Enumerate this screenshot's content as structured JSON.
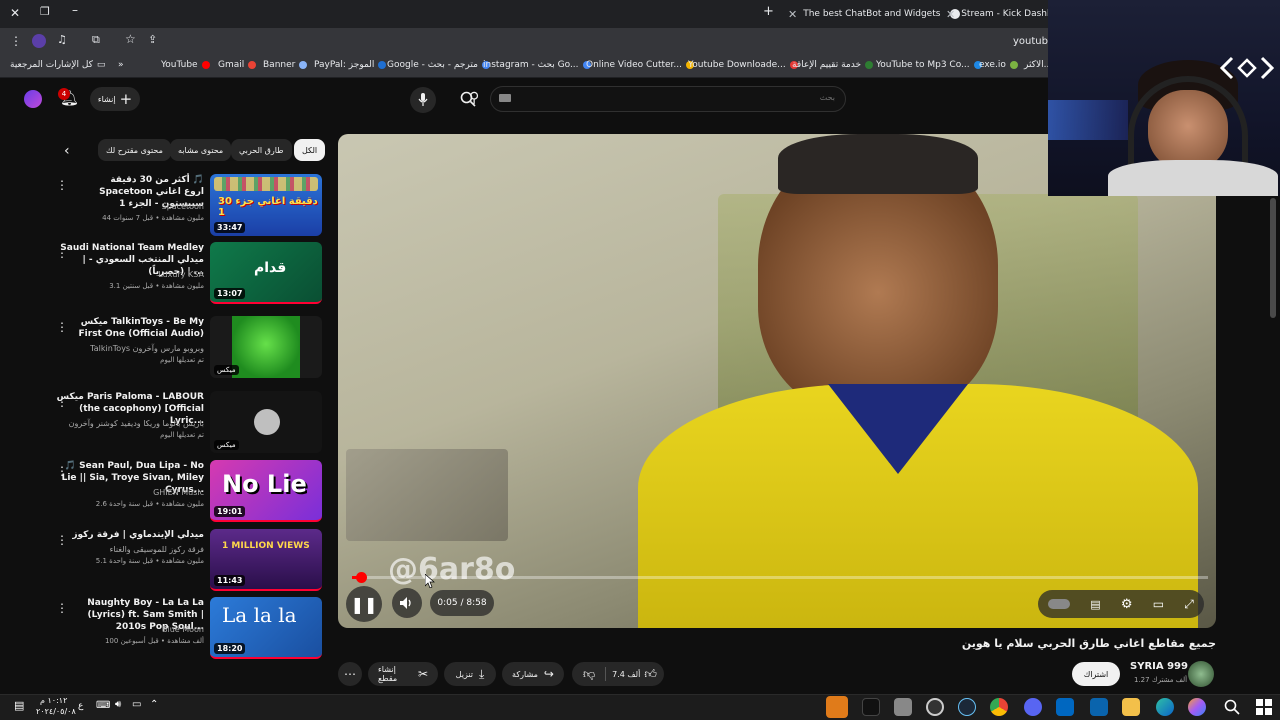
{
  "browser": {
    "tabs": [
      {
        "label": "The best ChatBot and Widgets"
      },
      {
        "label": "Stream - Kick Dashboard"
      }
    ],
    "address": "youtub",
    "bookmarks": [
      {
        "label": "كل الإشارات المرجعية"
      },
      {
        "label": "YouTube"
      },
      {
        "label": "Gmail"
      },
      {
        "label": "Banner"
      },
      {
        "label": "PayPal: الموجز"
      },
      {
        "label": "Google - مترجم - بحث"
      },
      {
        "label": "instagram - بحث Go..."
      },
      {
        "label": "Online Video Cutter..."
      },
      {
        "label": "Youtube Downloade..."
      },
      {
        "label": "خدمة تقييم الإعاقة"
      },
      {
        "label": "YouTube to Mp3 Co..."
      },
      {
        "label": "exe.io"
      },
      {
        "label": "الاكثر..."
      }
    ]
  },
  "youtube": {
    "create_label": "إنشاء",
    "notif_count": "4",
    "search_placeholder": "بحث",
    "chips": [
      {
        "label": "الكل",
        "active": true
      },
      {
        "label": "طارق الحربي"
      },
      {
        "label": "محتوى مشابه"
      },
      {
        "label": "محتوى مقترح لك"
      }
    ],
    "recommendations": [
      {
        "title": "أكثر من 30 دقيقة 🎵 Spacetoon اروع اغاني سبيستون - الجزء 1",
        "channel": "Spacetoon",
        "meta": "44 مليون مشاهدة • قبل 7 سنوات",
        "duration": "33:47",
        "thumb_text": "30 دقيقة اغاني جزء 1"
      },
      {
        "title": "Saudi National Team Medley | ميدلي المنتخب السعودي - (حصرياً) | ...",
        "channel": "Luxury KSA",
        "meta": "3.1 مليون مشاهدة • قبل سنتين",
        "duration": "13:07",
        "thumb_text": "قدام"
      },
      {
        "title": "ميكس TalkinToys - Be My First One (Official Audio)",
        "channel": "TalkinToys وبروبو مارس وآخرون",
        "meta": "تم تعديلها اليوم",
        "duration": "ميكس",
        "thumb_text": ""
      },
      {
        "title": "ميكس Paris Paloma - LABOUR (the cacophony) [Official Lyric...",
        "channel": "باريس بالوما وريكا وديفيد كوشنر وآخرون",
        "meta": "تم تعديلها اليوم",
        "duration": "ميكس",
        "thumb_text": ""
      },
      {
        "title": "🎵 Sean Paul, Dua Lipa - No Lie || Sia, Troye Sivan, Miley Cyrus...",
        "channel": "GHIEN Music",
        "meta": "2.6 مليون مشاهدة • قبل سنة واحدة",
        "duration": "19:01",
        "thumb_text": "No Lie"
      },
      {
        "title": "ميدلي الإيندماوي | فرقة ركوز",
        "channel": "فرقة ركوز للموسيقى والغناء",
        "meta": "5.1 مليون مشاهدة • قبل سنة واحدة",
        "duration": "11:43",
        "thumb_text": "1 MILLION VIEWS"
      },
      {
        "title": "Naughty Boy - La La La (Lyrics) ft. Sam Smith | 2010s Pop Soul...",
        "channel": "Blue Moon",
        "meta": "100 ألف مشاهدة • قبل أسبوعين",
        "duration": "18:20",
        "thumb_text": "La la la"
      }
    ],
    "player": {
      "time": "0:05 / 8:58",
      "watermark": "@6ar8o",
      "progress": 0.01
    },
    "video_title": "جميع مقاطع اغاني طارق الحربي سلام يا هوين",
    "channel_name": "SYRIA 999",
    "subscribers": "1.27 ألف مشترك",
    "subscribe_label": "اشتراك",
    "like_count": "7.4 ألف",
    "share_label": "مشاركة",
    "download_label": "تنزيل",
    "clip_label": "إنشاء مقطع"
  },
  "taskbar": {
    "time": "١٠:١٢ م",
    "date": "٢٠٢٤/٠٥/٠٨",
    "lang": "ع"
  }
}
